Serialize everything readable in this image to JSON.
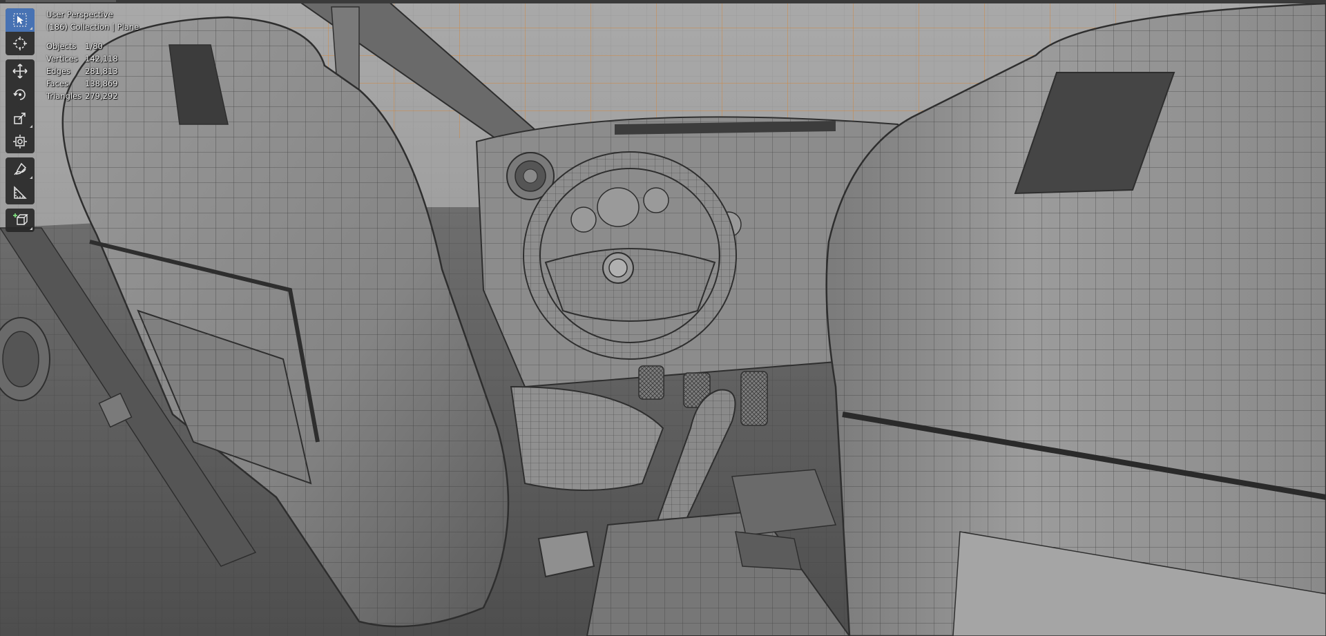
{
  "viewport": {
    "perspective_label": "User Perspective",
    "collection_label": "(186) Collection | Plane"
  },
  "stats": [
    {
      "label": "Objects",
      "value": "1/80"
    },
    {
      "label": "Vertices",
      "value": "142,118"
    },
    {
      "label": "Edges",
      "value": "281,813"
    },
    {
      "label": "Faces",
      "value": "138,869"
    },
    {
      "label": "Triangles",
      "value": "279,292"
    }
  ],
  "toolbar": {
    "tools": [
      {
        "name": "select-box-tool",
        "icon": "cursor-select-icon",
        "active": true
      },
      {
        "name": "cursor-tool",
        "icon": "3d-cursor-icon",
        "active": false
      },
      {
        "name": "move-tool",
        "icon": "move-arrows-icon",
        "active": false
      },
      {
        "name": "rotate-tool",
        "icon": "rotate-icon",
        "active": false
      },
      {
        "name": "scale-tool",
        "icon": "scale-icon",
        "active": false
      },
      {
        "name": "transform-tool",
        "icon": "transform-icon",
        "active": false
      },
      {
        "name": "annotate-tool",
        "icon": "annotate-pen-icon",
        "active": false
      },
      {
        "name": "measure-tool",
        "icon": "ruler-icon",
        "active": false
      },
      {
        "name": "add-cube-tool",
        "icon": "add-cube-icon",
        "active": false
      }
    ]
  },
  "colors": {
    "accent_active": "#4772b3",
    "wire_orange": "#d9832f",
    "mesh_gray": "#8a8a8a"
  }
}
